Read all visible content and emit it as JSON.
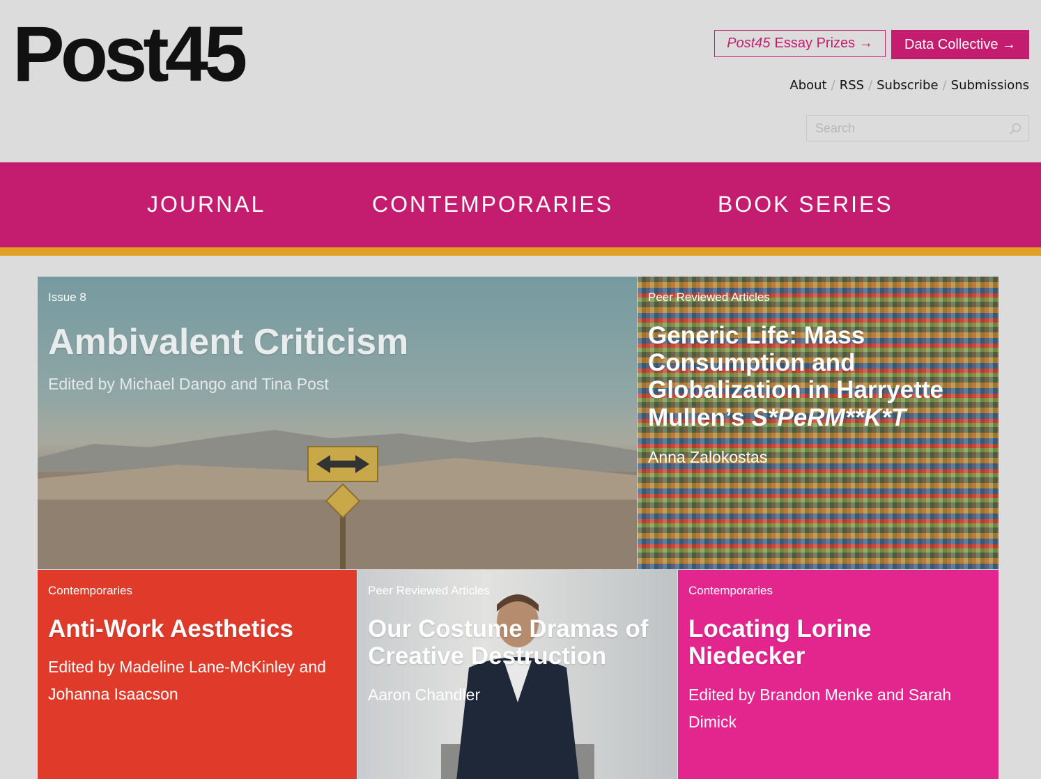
{
  "header": {
    "logo": "Post45",
    "prize_button": {
      "italic": "Post45",
      "label": "Essay Prizes →"
    },
    "data_button": "Data Collective →",
    "links": [
      "About",
      "RSS",
      "Subscribe",
      "Submissions"
    ],
    "separator": "/",
    "search_placeholder": "Search"
  },
  "nav": [
    "JOURNAL",
    "CONTEMPORARIES",
    "BOOK SERIES"
  ],
  "tiles": [
    {
      "kicker": "Issue 8",
      "title": "Ambivalent Criticism",
      "byline": "Edited by Michael Dango and Tina Post"
    },
    {
      "kicker": "Peer Reviewed Articles",
      "title": "Generic Life: Mass Consumption and Globalization in Harryette Mullen’s",
      "title_italic": "S*PeRM**K*T",
      "byline": "Anna Zalokostas"
    },
    {
      "kicker": "Contemporaries",
      "title": "Anti-Work Aesthetics",
      "byline": "Edited by Madeline Lane-McKinley and Johanna Isaacson"
    },
    {
      "kicker": "Peer Reviewed Articles",
      "title": "Our Costume Dramas of Creative Destruction",
      "byline": "Aaron Chandler"
    },
    {
      "kicker": "Contemporaries",
      "title": "Locating Lorine Niedecker",
      "byline": "Edited by Brandon Menke and Sarah Dimick"
    }
  ],
  "colors": {
    "brand": "#c41c6e",
    "accent": "#e0a021",
    "background": "#dcdcdc"
  },
  "icons": {
    "search": "search-icon"
  }
}
